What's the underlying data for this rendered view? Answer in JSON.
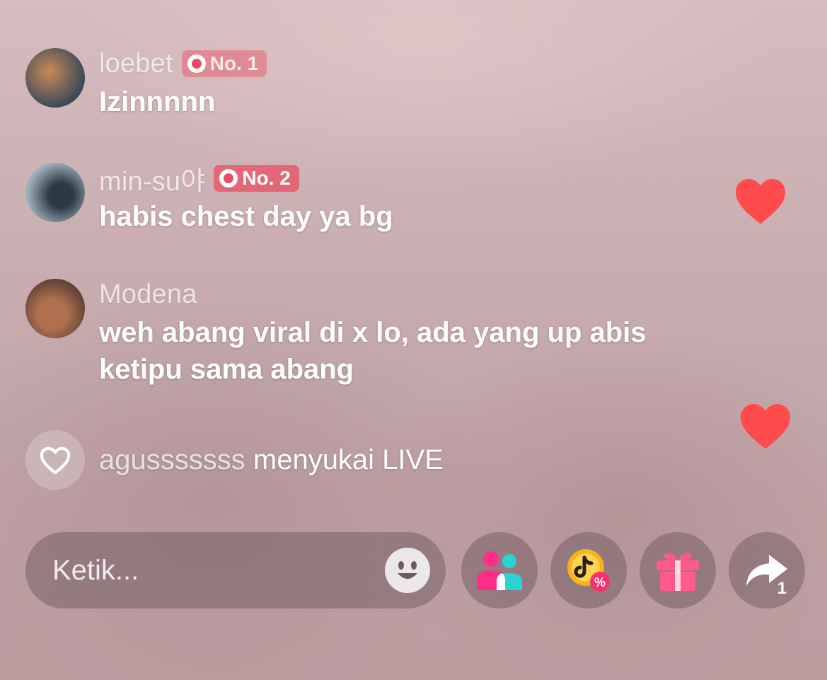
{
  "comments": [
    {
      "username": "loebet",
      "badge": "No. 1",
      "text": "Izinnnnn"
    },
    {
      "username": "min-su야",
      "badge": "No. 2",
      "text": "habis chest day ya bg"
    },
    {
      "username": "Modena",
      "badge": "",
      "text": "weh abang viral di x lo, ada yang up abis ketipu sama abang"
    }
  ],
  "like_event": {
    "username": "agusssssss",
    "action": "menyukai LIVE"
  },
  "bottom_bar": {
    "input_placeholder": "Ketik...",
    "share_count": "1"
  },
  "colors": {
    "heart": "#ff4b4b",
    "badge": "#e84d63",
    "collab_pink": "#ff2d87",
    "collab_cyan": "#29d4d4",
    "coin_gold": "#f7b21c",
    "gift_pink": "#ff5a8a"
  }
}
